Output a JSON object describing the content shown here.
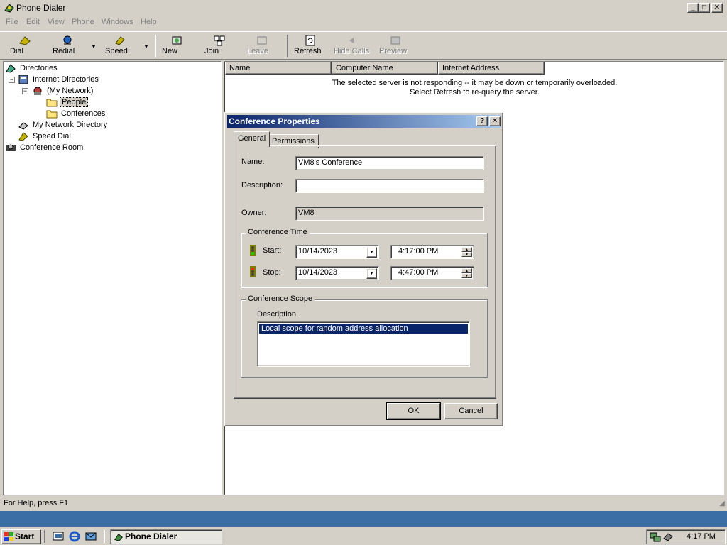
{
  "window": {
    "title": "Phone Dialer"
  },
  "menu": [
    "File",
    "Edit",
    "View",
    "Phone",
    "Windows",
    "Help"
  ],
  "toolbar": {
    "dial": "Dial",
    "redial": "Redial",
    "speed": "Speed",
    "new": "New",
    "join": "Join",
    "leave": "Leave",
    "refresh": "Refresh",
    "hide_calls": "Hide Calls",
    "preview": "Preview"
  },
  "tree": {
    "directories": "Directories",
    "internet_directories": "Internet Directories",
    "my_network": "(My Network)",
    "people": "People",
    "conferences": "Conferences",
    "my_network_directory": "My Network Directory",
    "speed_dial": "Speed Dial",
    "conference_room": "Conference Room"
  },
  "list": {
    "columns": [
      "Name",
      "Computer Name",
      "Internet Address"
    ],
    "message_line1": "The selected server is not responding -- it may be down or temporarily overloaded.",
    "message_line2": "Select Refresh to re-query the server."
  },
  "status": {
    "text": "For Help, press F1"
  },
  "dialog": {
    "title": "Conference Properties",
    "help_btn": "?",
    "close_btn": "✕",
    "tabs": [
      "General",
      "Permissions"
    ],
    "name_label": "Name:",
    "name_value": "VM8's Conference",
    "description_label": "Description:",
    "description_value": "",
    "owner_label": "Owner:",
    "owner_value": "VM8",
    "time_group": "Conference Time",
    "start_label": "Start:",
    "start_date": "10/14/2023",
    "start_time": "4:17:00 PM",
    "stop_label": "Stop:",
    "stop_date": "10/14/2023",
    "stop_time": "4:47:00 PM",
    "scope_group": "Conference Scope",
    "scope_desc_label": "Description:",
    "scope_item": "Local scope for random address allocation",
    "ok": "OK",
    "cancel": "Cancel"
  },
  "taskbar": {
    "start": "Start",
    "task": "Phone Dialer",
    "clock": "4:17 PM"
  }
}
